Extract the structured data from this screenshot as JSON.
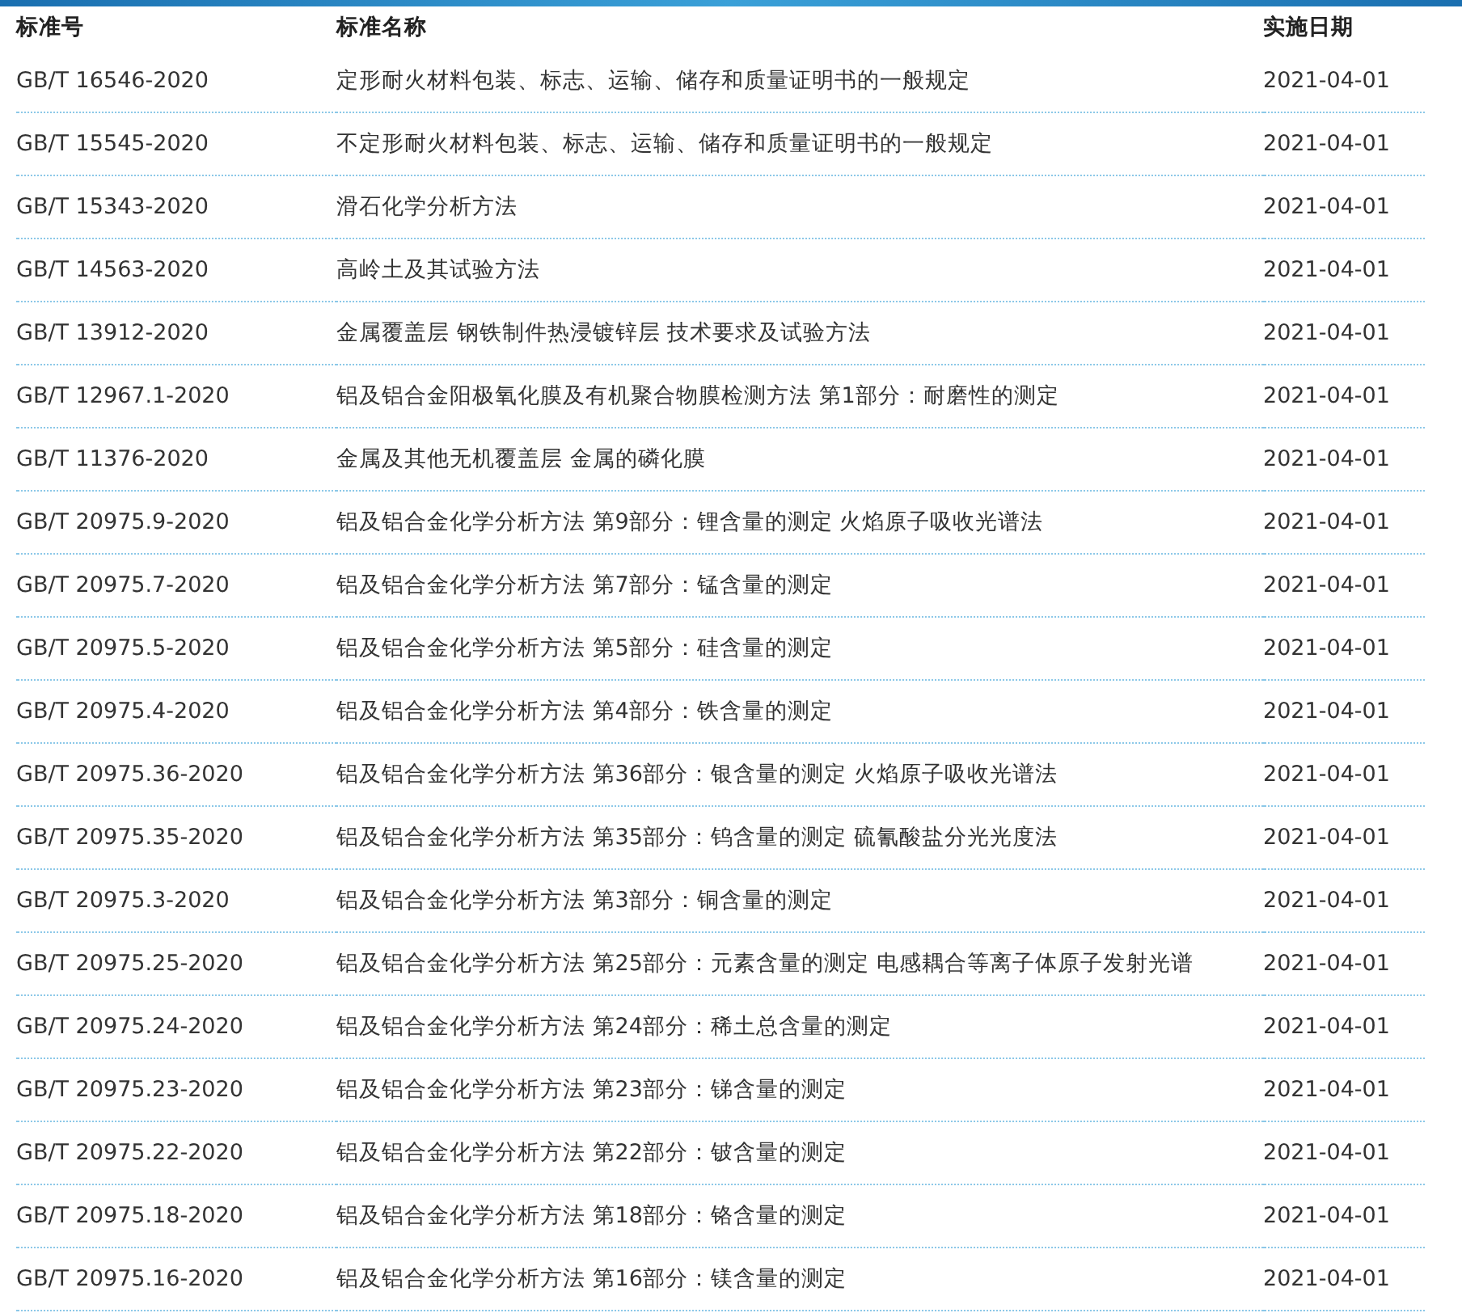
{
  "table": {
    "columns": [
      "标准号",
      "标准名称",
      "实施日期"
    ],
    "rows": [
      [
        "GB/T 16546-2020",
        "定形耐火材料包装、标志、运输、储存和质量证明书的一般规定",
        "2021-04-01"
      ],
      [
        "GB/T 15545-2020",
        "不定形耐火材料包装、标志、运输、储存和质量证明书的一般规定",
        "2021-04-01"
      ],
      [
        "GB/T 15343-2020",
        "滑石化学分析方法",
        "2021-04-01"
      ],
      [
        "GB/T 14563-2020",
        "高岭土及其试验方法",
        "2021-04-01"
      ],
      [
        "GB/T 13912-2020",
        "金属覆盖层 钢铁制件热浸镀锌层 技术要求及试验方法",
        "2021-04-01"
      ],
      [
        "GB/T 12967.1-2020",
        "铝及铝合金阳极氧化膜及有机聚合物膜检测方法 第1部分：耐磨性的测定",
        "2021-04-01"
      ],
      [
        "GB/T 11376-2020",
        "金属及其他无机覆盖层 金属的磷化膜",
        "2021-04-01"
      ],
      [
        "GB/T 20975.9-2020",
        "铝及铝合金化学分析方法 第9部分：锂含量的测定 火焰原子吸收光谱法",
        "2021-04-01"
      ],
      [
        "GB/T 20975.7-2020",
        "铝及铝合金化学分析方法 第7部分：锰含量的测定",
        "2021-04-01"
      ],
      [
        "GB/T 20975.5-2020",
        "铝及铝合金化学分析方法 第5部分：硅含量的测定",
        "2021-04-01"
      ],
      [
        "GB/T 20975.4-2020",
        "铝及铝合金化学分析方法 第4部分：铁含量的测定",
        "2021-04-01"
      ],
      [
        "GB/T 20975.36-2020",
        "铝及铝合金化学分析方法 第36部分：银含量的测定 火焰原子吸收光谱法",
        "2021-04-01"
      ],
      [
        "GB/T 20975.35-2020",
        "铝及铝合金化学分析方法 第35部分：钨含量的测定 硫氰酸盐分光光度法",
        "2021-04-01"
      ],
      [
        "GB/T 20975.3-2020",
        "铝及铝合金化学分析方法 第3部分：铜含量的测定",
        "2021-04-01"
      ],
      [
        "GB/T 20975.25-2020",
        "铝及铝合金化学分析方法 第25部分：元素含量的测定 电感耦合等离子体原子发射光谱",
        "2021-04-01"
      ],
      [
        "GB/T 20975.24-2020",
        "铝及铝合金化学分析方法 第24部分：稀土总含量的测定",
        "2021-04-01"
      ],
      [
        "GB/T 20975.23-2020",
        "铝及铝合金化学分析方法 第23部分：锑含量的测定",
        "2021-04-01"
      ],
      [
        "GB/T 20975.22-2020",
        "铝及铝合金化学分析方法 第22部分：铍含量的测定",
        "2021-04-01"
      ],
      [
        "GB/T 20975.18-2020",
        "铝及铝合金化学分析方法 第18部分：铬含量的测定",
        "2021-04-01"
      ],
      [
        "GB/T 20975.16-2020",
        "铝及铝合金化学分析方法 第16部分：镁含量的测定",
        "2021-04-01"
      ]
    ]
  }
}
